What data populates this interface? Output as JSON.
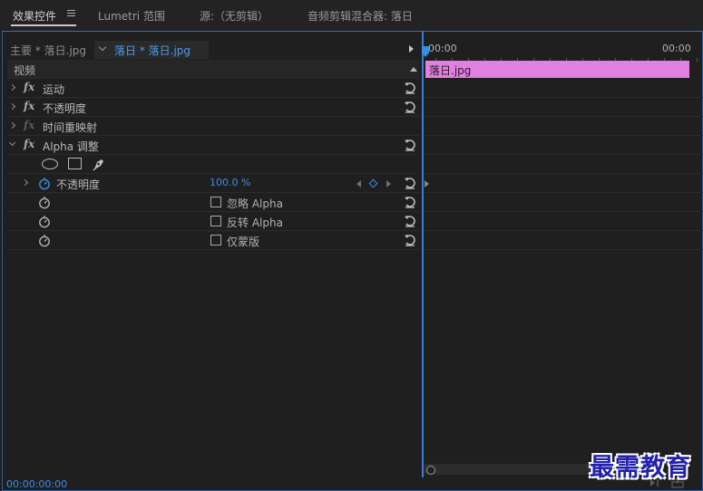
{
  "tabs": [
    {
      "label": "效果控件",
      "active": true
    },
    {
      "label": "Lumetri 范围",
      "active": false
    },
    {
      "label": "源:（无剪辑）",
      "active": false
    },
    {
      "label": "音频剪辑混合器: 落日",
      "active": false
    }
  ],
  "clip_header": {
    "master": "主要 * 落日.jpg",
    "sequence": "落日 * 落日.jpg"
  },
  "sections": {
    "video": "视频"
  },
  "effects": [
    {
      "label": "运动",
      "expanded": false,
      "fx_enabled": true
    },
    {
      "label": "不透明度",
      "expanded": false,
      "fx_enabled": true
    },
    {
      "label": "时间重映射",
      "expanded": false,
      "fx_enabled": false
    },
    {
      "label": "Alpha 调整",
      "expanded": true,
      "fx_enabled": true
    }
  ],
  "alpha_adjust": {
    "opacity_label": "不透明度",
    "opacity_value": "100.0",
    "opacity_unit": "%",
    "options": [
      {
        "label": "忽略 Alpha",
        "checked": false
      },
      {
        "label": "反转 Alpha",
        "checked": false
      },
      {
        "label": "仅蒙版",
        "checked": false
      }
    ]
  },
  "timeline": {
    "start_time": "00:00",
    "end_time": "00:00",
    "clip_name": "落日.jpg"
  },
  "footer": {
    "timecode": "00:00:00:00"
  },
  "watermark": "最需教育",
  "colors": {
    "accent": "#3a8ee6",
    "clip": "#e180e0",
    "background": "#1e1e1e"
  },
  "icons": [
    "menu-icon",
    "chevron-right-icon",
    "chevron-down-icon",
    "fx-icon",
    "reset-icon",
    "ellipse-mask-icon",
    "rectangle-mask-icon",
    "pen-mask-icon",
    "stopwatch-icon",
    "keyframe-diamond-icon",
    "play-icon",
    "collapse-icon"
  ]
}
